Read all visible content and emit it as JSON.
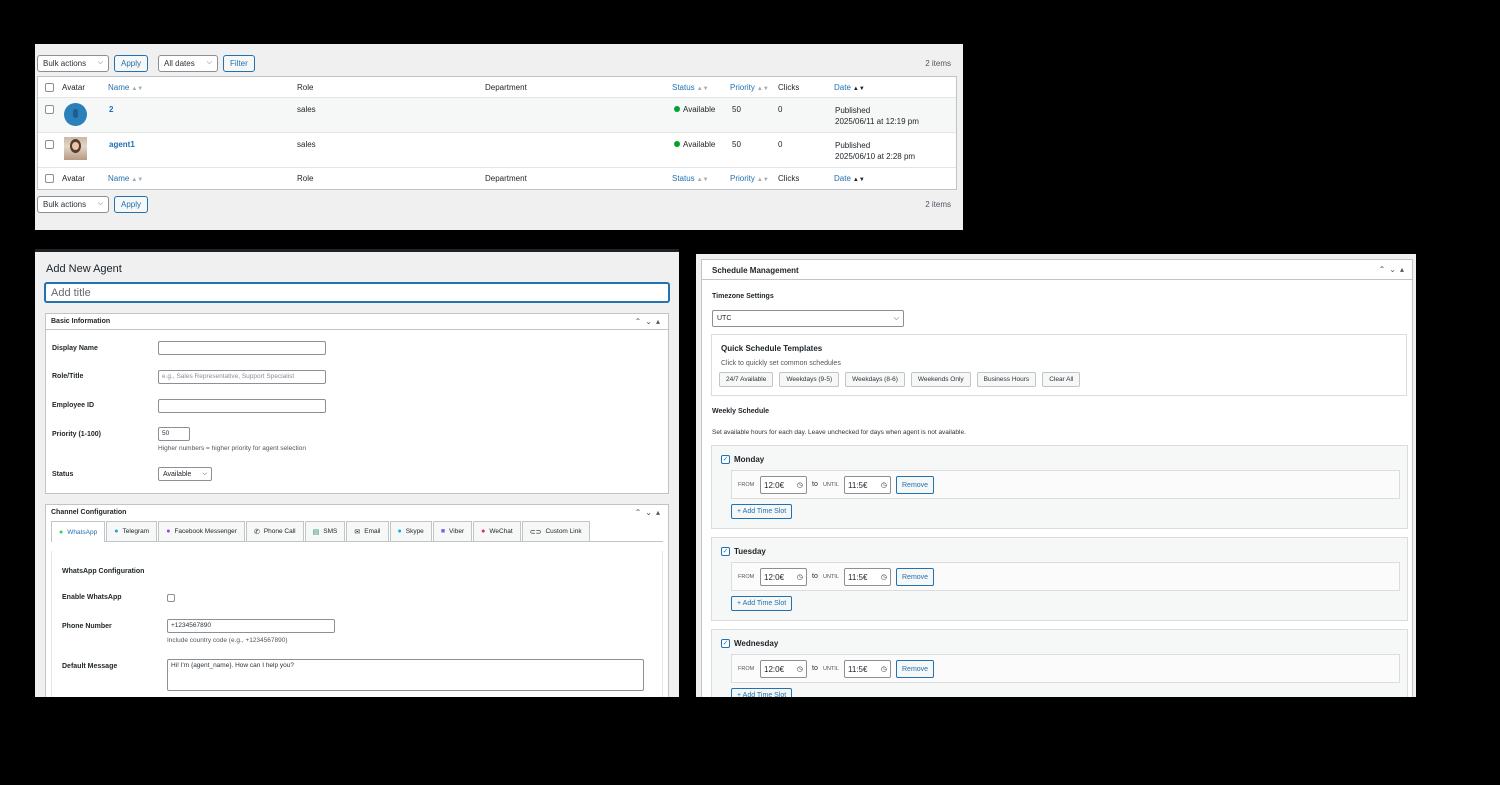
{
  "list": {
    "bulk_actions": "Bulk actions",
    "apply": "Apply",
    "all_dates": "All dates",
    "filter": "Filter",
    "items_count": "2 items",
    "columns": {
      "avatar": "Avatar",
      "name": "Name",
      "role": "Role",
      "department": "Department",
      "status": "Status",
      "priority": "Priority",
      "clicks": "Clicks",
      "date": "Date"
    },
    "rows": [
      {
        "name": "2",
        "role": "sales",
        "department": "",
        "status": "Available",
        "priority": "50",
        "clicks": "0",
        "date_status": "Published",
        "date": "2025/06/11 at 12:19 pm"
      },
      {
        "name": "agent1",
        "role": "sales",
        "department": "",
        "status": "Available",
        "priority": "50",
        "clicks": "0",
        "date_status": "Published",
        "date": "2025/06/10 at 2:28 pm"
      }
    ]
  },
  "agent": {
    "heading": "Add New Agent",
    "title_placeholder": "Add title",
    "basic": {
      "title": "Basic Information",
      "display_name_label": "Display Name",
      "role_label": "Role/Title",
      "role_placeholder": "e.g., Sales Representative, Support Specialist",
      "employee_id_label": "Employee ID",
      "priority_label": "Priority (1-100)",
      "priority_value": "50",
      "priority_desc": "Higher numbers = higher priority for agent selection",
      "status_label": "Status",
      "status_value": "Available"
    },
    "channels": {
      "title": "Channel Configuration",
      "tabs": [
        "WhatsApp",
        "Telegram",
        "Facebook Messenger",
        "Phone Call",
        "SMS",
        "Email",
        "Skype",
        "Viber",
        "WeChat",
        "Custom Link"
      ],
      "section_title": "WhatsApp Configuration",
      "enable_label": "Enable WhatsApp",
      "phone_label": "Phone Number",
      "phone_value": "+1234567890",
      "phone_desc": "Include country code (e.g., +1234567890)",
      "message_label": "Default Message",
      "message_value": "Hi! I'm {agent_name}. How can I help you?"
    }
  },
  "schedule": {
    "title": "Schedule Management",
    "timezone_label": "Timezone Settings",
    "timezone_value": "UTC",
    "templates_title": "Quick Schedule Templates",
    "templates_desc": "Click to quickly set common schedules",
    "templates": [
      "24/7 Available",
      "Weekdays (9-5)",
      "Weekdays (8-6)",
      "Weekends Only",
      "Business Hours",
      "Clear All"
    ],
    "weekly_title": "Weekly Schedule",
    "weekly_desc": "Set available hours for each day. Leave unchecked for days when agent is not available.",
    "from_label": "FROM",
    "to_label": "to",
    "until_label": "UNTIL",
    "remove_label": "Remove",
    "add_slot_label": "+ Add Time Slot",
    "days": [
      {
        "name": "Monday",
        "from": "12:0€",
        "until": "11:5€"
      },
      {
        "name": "Tuesday",
        "from": "12:0€",
        "until": "11:5€"
      },
      {
        "name": "Wednesday",
        "from": "12:0€",
        "until": "11:5€"
      }
    ]
  }
}
